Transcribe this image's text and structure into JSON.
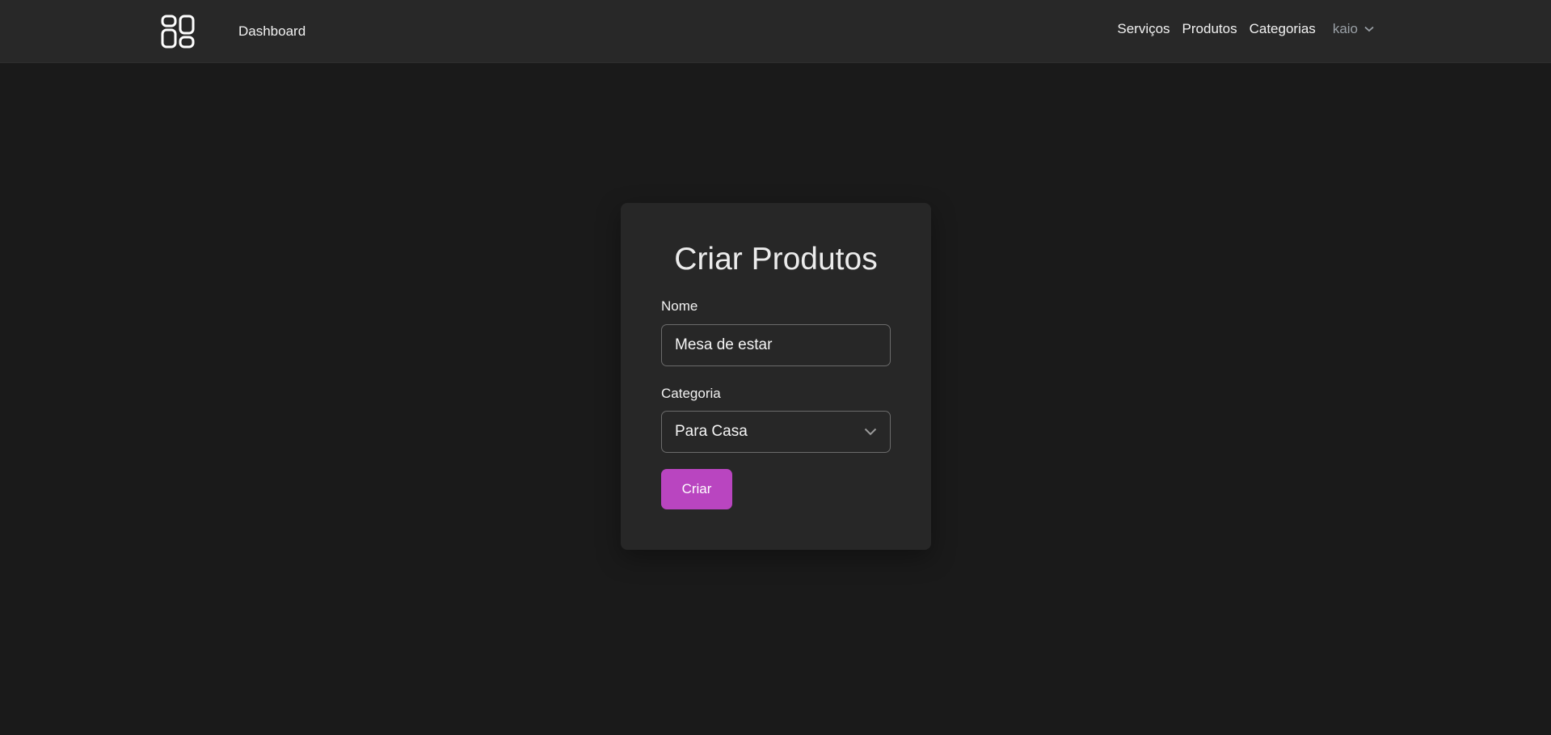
{
  "header": {
    "brand_label": "Dashboard",
    "nav": {
      "services": "Serviços",
      "products": "Produtos",
      "categories": "Categorias"
    },
    "user_name": "kaio"
  },
  "form": {
    "title": "Criar Produtos",
    "name_label": "Nome",
    "name_value": "Mesa de estar",
    "category_label": "Categoria",
    "category_selected": "Para Casa",
    "submit_label": "Criar"
  },
  "colors": {
    "background": "#1a1a1a",
    "topbar": "#282828",
    "card": "#272727",
    "accent": "#b945c0",
    "muted": "#9aa0a6"
  },
  "icons": {
    "logo": "grid-apps-icon",
    "user_menu": "chevron-down-icon",
    "select": "chevron-down-icon"
  }
}
